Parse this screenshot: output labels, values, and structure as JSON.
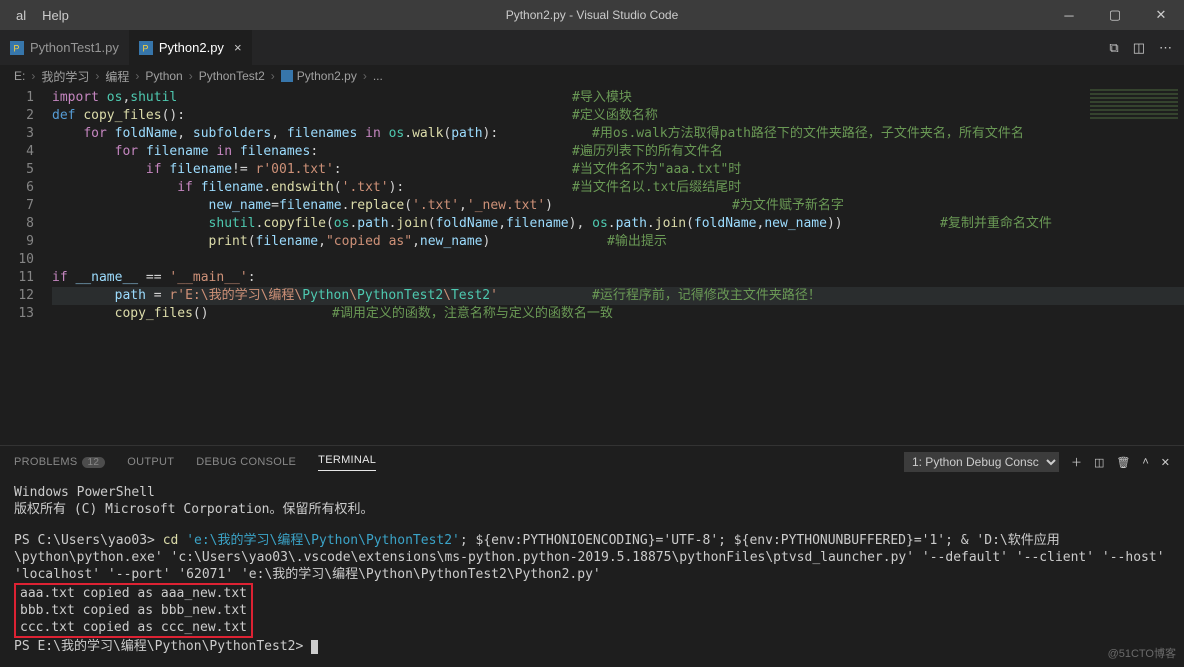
{
  "titlebar": {
    "menu_terminal": "al",
    "menu_help": "Help",
    "title": "Python2.py - Visual Studio Code"
  },
  "tabs": [
    {
      "label": "PythonTest1.py",
      "active": false
    },
    {
      "label": "Python2.py",
      "active": true
    }
  ],
  "breadcrumb": [
    "E:",
    "我的学习",
    "编程",
    "Python",
    "PythonTest2",
    "Python2.py",
    "..."
  ],
  "code": {
    "lines": [
      {
        "n": 1,
        "indent": 0,
        "segs": [
          [
            "key",
            "import "
          ],
          [
            "mod",
            "os"
          ],
          [
            "plain",
            ","
          ],
          [
            "mod",
            "shutil"
          ]
        ],
        "comment": "#导入模块",
        "ccol": 520
      },
      {
        "n": 2,
        "indent": 0,
        "segs": [
          [
            "def",
            "def "
          ],
          [
            "func",
            "copy_files"
          ],
          [
            "plain",
            "():"
          ]
        ],
        "comment": "#定义函数名称",
        "ccol": 520
      },
      {
        "n": 3,
        "indent": 1,
        "segs": [
          [
            "key",
            "for "
          ],
          [
            "id",
            "foldName"
          ],
          [
            "plain",
            ", "
          ],
          [
            "id",
            "subfolders"
          ],
          [
            "plain",
            ", "
          ],
          [
            "id",
            "filenames"
          ],
          [
            "key",
            " in "
          ],
          [
            "mod",
            "os"
          ],
          [
            "plain",
            "."
          ],
          [
            "func",
            "walk"
          ],
          [
            "plain",
            "("
          ],
          [
            "id",
            "path"
          ],
          [
            "plain",
            "):"
          ]
        ],
        "comment": "#用os.walk方法取得path路径下的文件夹路径，子文件夹名，所有文件名",
        "ccol": 540
      },
      {
        "n": 4,
        "indent": 2,
        "segs": [
          [
            "key",
            "for "
          ],
          [
            "id",
            "filename"
          ],
          [
            "key",
            " in "
          ],
          [
            "id",
            "filenames"
          ],
          [
            "plain",
            ":"
          ]
        ],
        "comment": "#遍历列表下的所有文件名",
        "ccol": 520
      },
      {
        "n": 5,
        "indent": 3,
        "segs": [
          [
            "key",
            "if "
          ],
          [
            "id",
            "filename"
          ],
          [
            "plain",
            "!= "
          ],
          [
            "str",
            "r'001.txt'"
          ],
          [
            "plain",
            ":"
          ]
        ],
        "comment": "#当文件名不为\"aaa.txt\"时",
        "ccol": 520
      },
      {
        "n": 6,
        "indent": 4,
        "segs": [
          [
            "key",
            "if "
          ],
          [
            "id",
            "filename"
          ],
          [
            "plain",
            "."
          ],
          [
            "func",
            "endswith"
          ],
          [
            "plain",
            "("
          ],
          [
            "str",
            "'.txt'"
          ],
          [
            "plain",
            "):"
          ]
        ],
        "comment": "#当文件名以.txt后缀结尾时",
        "ccol": 520
      },
      {
        "n": 7,
        "indent": 5,
        "segs": [
          [
            "id",
            "new_name"
          ],
          [
            "plain",
            "="
          ],
          [
            "id",
            "filename"
          ],
          [
            "plain",
            "."
          ],
          [
            "func",
            "replace"
          ],
          [
            "plain",
            "("
          ],
          [
            "str",
            "'.txt'"
          ],
          [
            "plain",
            ","
          ],
          [
            "str",
            "'_new.txt'"
          ],
          [
            "plain",
            ")"
          ]
        ],
        "comment": "#为文件赋予新名字",
        "ccol": 680
      },
      {
        "n": 8,
        "indent": 5,
        "segs": [
          [
            "mod",
            "shutil"
          ],
          [
            "plain",
            "."
          ],
          [
            "func",
            "copyfile"
          ],
          [
            "plain",
            "("
          ],
          [
            "mod",
            "os"
          ],
          [
            "plain",
            "."
          ],
          [
            "id",
            "path"
          ],
          [
            "plain",
            "."
          ],
          [
            "func",
            "join"
          ],
          [
            "plain",
            "("
          ],
          [
            "id",
            "foldName"
          ],
          [
            "plain",
            ","
          ],
          [
            "id",
            "filename"
          ],
          [
            "plain",
            "), "
          ],
          [
            "mod",
            "os"
          ],
          [
            "plain",
            "."
          ],
          [
            "id",
            "path"
          ],
          [
            "plain",
            "."
          ],
          [
            "func",
            "join"
          ],
          [
            "plain",
            "("
          ],
          [
            "id",
            "foldName"
          ],
          [
            "plain",
            ","
          ],
          [
            "id",
            "new_name"
          ],
          [
            "plain",
            "))"
          ]
        ],
        "comment": "#复制并重命名文件",
        "ccol": 888
      },
      {
        "n": 9,
        "indent": 5,
        "segs": [
          [
            "func",
            "print"
          ],
          [
            "plain",
            "("
          ],
          [
            "id",
            "filename"
          ],
          [
            "plain",
            ","
          ],
          [
            "str",
            "\"copied as\""
          ],
          [
            "plain",
            ","
          ],
          [
            "id",
            "new_name"
          ],
          [
            "plain",
            ")"
          ]
        ],
        "comment": "#输出提示",
        "ccol": 555
      },
      {
        "n": 10,
        "indent": 0,
        "segs": []
      },
      {
        "n": 11,
        "indent": 0,
        "segs": [
          [
            "key",
            "if "
          ],
          [
            "id",
            "__name__"
          ],
          [
            "plain",
            " == "
          ],
          [
            "str",
            "'__main__'"
          ],
          [
            "plain",
            ":"
          ]
        ]
      },
      {
        "n": 12,
        "indent": 2,
        "hl": true,
        "segs": [
          [
            "id",
            "path"
          ],
          [
            "plain",
            " = "
          ],
          [
            "str",
            "r'E:\\"
          ],
          [
            "str",
            "我的学习"
          ],
          [
            "str",
            "\\"
          ],
          [
            "str",
            "编程"
          ],
          [
            "str",
            "\\"
          ],
          [
            "mod",
            "Python"
          ],
          [
            "str",
            "\\"
          ],
          [
            "mod",
            "PythonTest2"
          ],
          [
            "str",
            "\\"
          ],
          [
            "mod",
            "Test2"
          ],
          [
            "str",
            "'"
          ]
        ],
        "comment": "#运行程序前，记得修改主文件夹路径！",
        "ccol": 540
      },
      {
        "n": 13,
        "indent": 2,
        "segs": [
          [
            "func",
            "copy_files"
          ],
          [
            "plain",
            "()"
          ]
        ],
        "comment": "#调用定义的函数，注意名称与定义的函数名一致",
        "ccol": 280
      }
    ]
  },
  "panel": {
    "tabs": {
      "problems": "Problems",
      "problems_count": "12",
      "output": "Output",
      "debug": "Debug Console",
      "terminal": "Terminal"
    },
    "selector": "1: Python Debug Consc"
  },
  "terminal": {
    "line1": "Windows PowerShell",
    "line2": "版权所有 (C) Microsoft Corporation。保留所有权利。",
    "prompt1": "PS C:\\Users\\yao03>",
    "cd": "cd",
    "cd_arg": "'e:\\我的学习\\编程\\Python\\PythonTest2'",
    "rest1": "; ${env:PYTHONIOENCODING}='UTF-8'; ${env:PYTHONUNBUFFERED}='1'; & 'D:\\软件应用\\python\\python.exe' 'c:\\Users\\yao03\\.vscode\\extensions\\ms-python.python-2019.5.18875\\pythonFiles\\ptvsd_launcher.py' '--default' '--client' '--host' 'localhost' '--port' '62071' 'e:\\我的学习\\编程\\Python\\PythonTest2\\Python2.py'",
    "out": [
      "aaa.txt copied as aaa_new.txt",
      "bbb.txt copied as bbb_new.txt",
      "ccc.txt copied as ccc_new.txt"
    ],
    "prompt2": "PS E:\\我的学习\\编程\\Python\\PythonTest2>"
  },
  "watermark": "@51CTO博客"
}
